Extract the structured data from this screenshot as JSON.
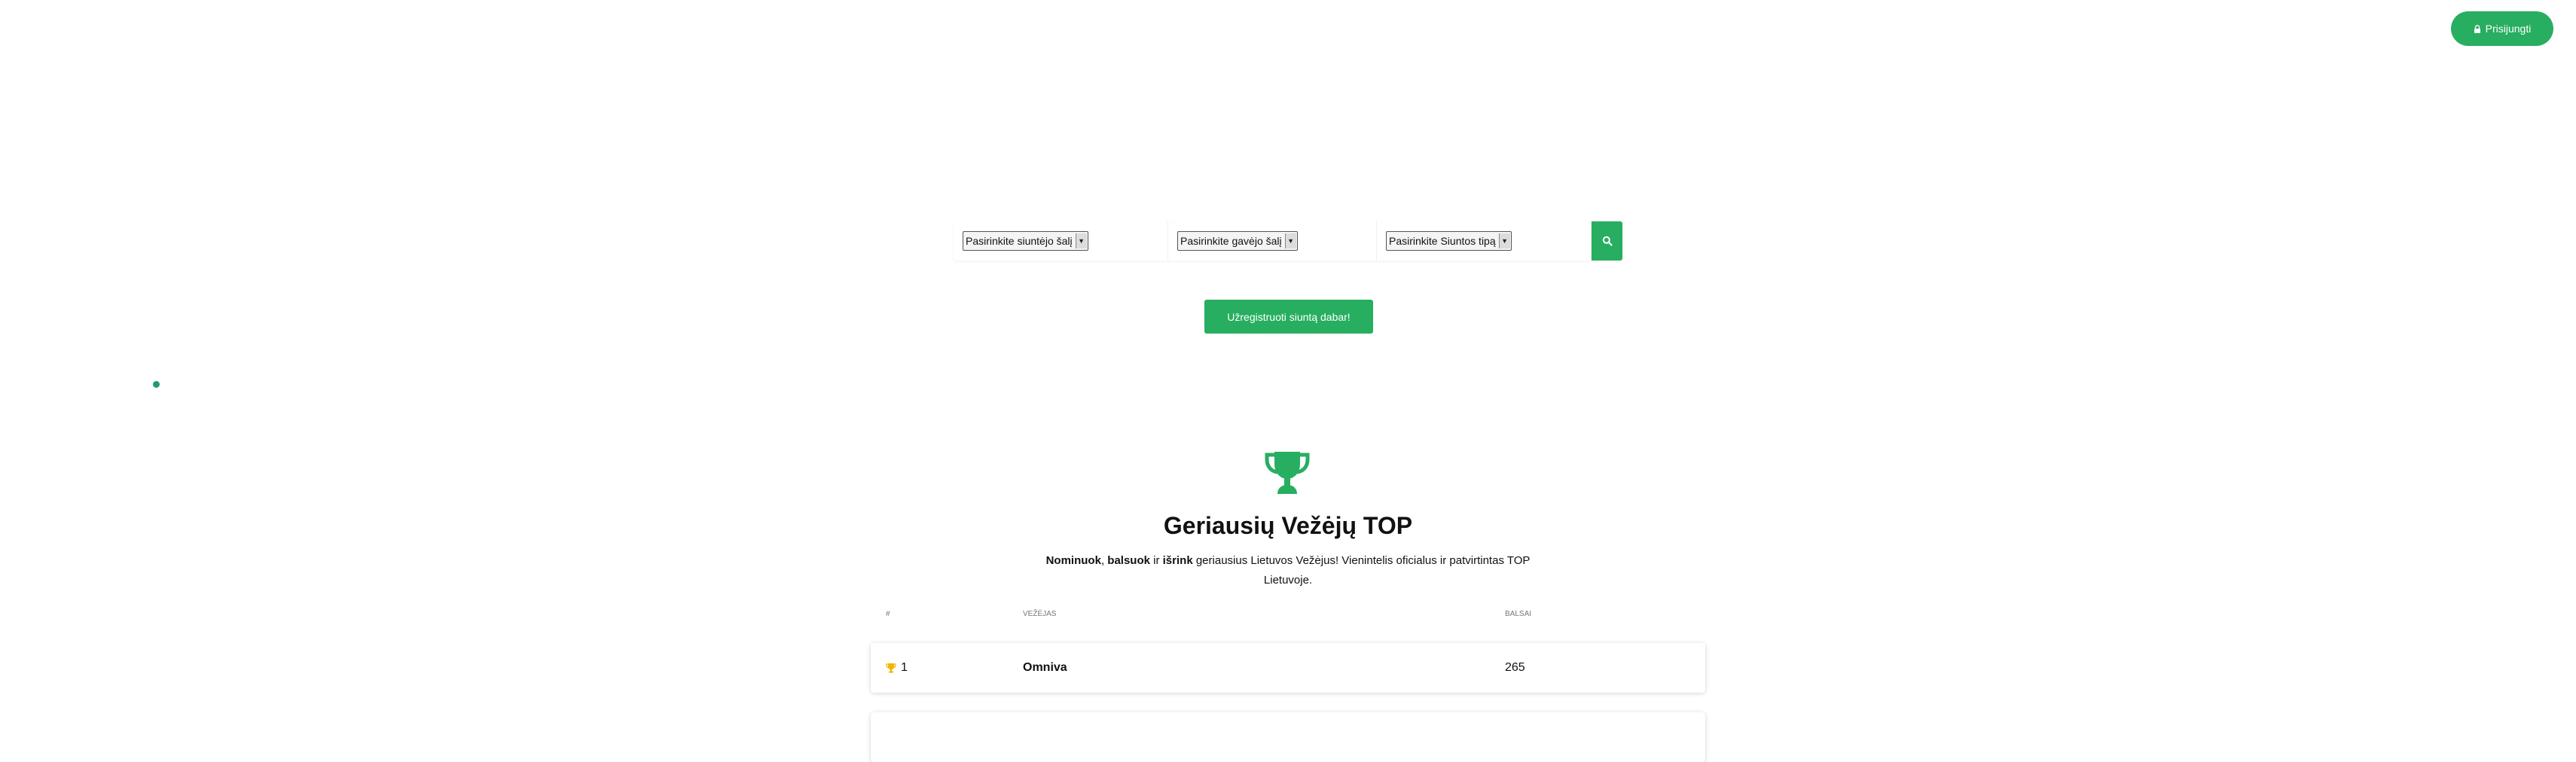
{
  "header": {
    "login_label": "Prisijungti",
    "login_icon": "lock-icon"
  },
  "search": {
    "sender_country": "Pasirinkite siuntėjo šalį",
    "receiver_country": "Pasirinkite gavėjo šalį",
    "parcel_type": "Pasirinkite Siuntos tipą",
    "search_icon": "search-icon"
  },
  "register_label": "Užregistruoti siuntą dabar!",
  "top": {
    "icon": "trophy-icon",
    "title": "Geriausių Vežėjų TOP",
    "subtitle_bold1": "Nominuok",
    "subtitle_sep1": ", ",
    "subtitle_bold2": "balsuok",
    "subtitle_sep2": " ir ",
    "subtitle_bold3": "išrink",
    "subtitle_rest": " geriausius Lietuvos Vežėjus! Vienintelis oficialus ir patvirtintas TOP Lietuvoje.",
    "columns": [
      "#",
      "VEŽĖJAS",
      "BALSAI"
    ],
    "rows": [
      {
        "rank": "1",
        "carrier": "Omniva",
        "votes": "265"
      }
    ]
  },
  "colors": {
    "accent": "#27ae60",
    "dot": "#1e9a7a",
    "trophy_gold": "#f1b500"
  }
}
